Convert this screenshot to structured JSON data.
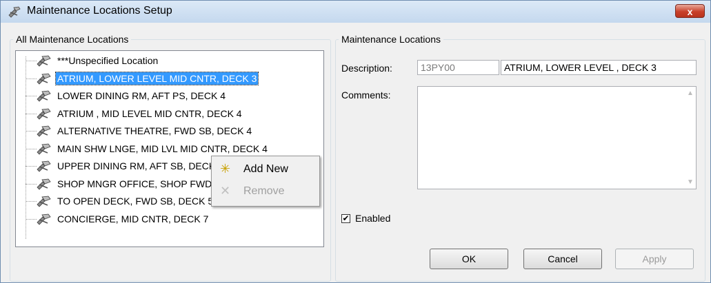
{
  "window": {
    "title": "Maintenance Locations Setup",
    "close_label": "x"
  },
  "left_group": {
    "legend": "All Maintenance Locations",
    "tree": [
      {
        "label": "***Unspecified Location",
        "selected": false
      },
      {
        "label": "ATRIUM, LOWER LEVEL MID CNTR, DECK 3",
        "selected": true
      },
      {
        "label": "LOWER DINING RM,  AFT PS, DECK 4",
        "selected": false
      },
      {
        "label": "ATRIUM , MID LEVEL MID CNTR, DECK 4",
        "selected": false
      },
      {
        "label": "ALTERNATIVE THEATRE,  FWD SB, DECK 4",
        "selected": false
      },
      {
        "label": "MAIN SHW LNGE, MID LVL MID CNTR, DECK 4",
        "selected": false
      },
      {
        "label": "UPPER DINING RM,  AFT SB, DECK 5",
        "selected": false
      },
      {
        "label": "SHOP MNGR OFFICE, SHOP FWD SB, DECK 5",
        "selected": false
      },
      {
        "label": "TO OPEN DECK,  FWD SB, DECK 5",
        "selected": false
      },
      {
        "label": "CONCIERGE,  MID CNTR, DECK 7",
        "selected": false
      }
    ]
  },
  "context_menu": {
    "items": [
      {
        "label": "Add New",
        "icon": "sparkle-icon",
        "enabled": true
      },
      {
        "label": "Remove",
        "icon": "x-icon",
        "enabled": false
      }
    ]
  },
  "right_group": {
    "legend": "Maintenance Locations",
    "description_label": "Description:",
    "description_code": "13PY00",
    "description_value": "ATRIUM, LOWER LEVEL , DECK 3",
    "comments_label": "Comments:",
    "comments_value": "",
    "enabled_label": "Enabled",
    "enabled_checked": true
  },
  "buttons": {
    "ok": "OK",
    "cancel": "Cancel",
    "apply": "Apply"
  },
  "colors": {
    "selection": "#3399ff",
    "close_button": "#c8402a"
  }
}
